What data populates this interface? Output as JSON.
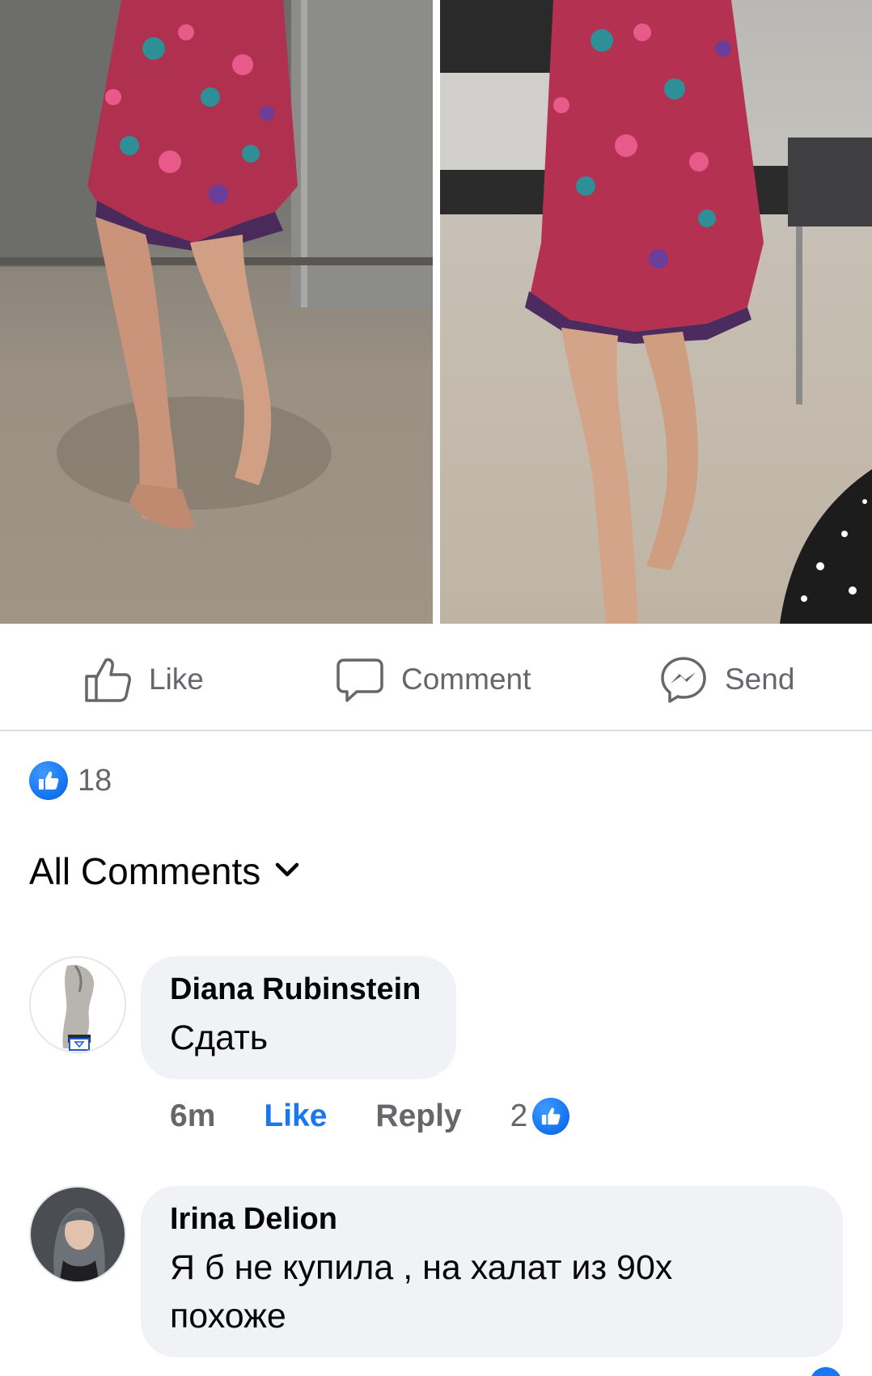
{
  "actions": {
    "like_label": "Like",
    "comment_label": "Comment",
    "send_label": "Send"
  },
  "reactions": {
    "count": "18",
    "icon": "like-icon"
  },
  "comments_header": {
    "label": "All Comments",
    "icon": "chevron-down-icon"
  },
  "comments": [
    {
      "author": "Diana Rubinstein",
      "text": "Сдать",
      "time": "6m",
      "like_label": "Like",
      "reply_label": "Reply",
      "reaction_count": "2"
    },
    {
      "author": "Irina Delion",
      "text_line1": "Я б не купила , на халат из 90х",
      "text_line2": "похоже"
    }
  ],
  "colors": {
    "accent": "#1877f2",
    "secondary_text": "#65676b",
    "bubble_bg": "#f0f2f5"
  }
}
